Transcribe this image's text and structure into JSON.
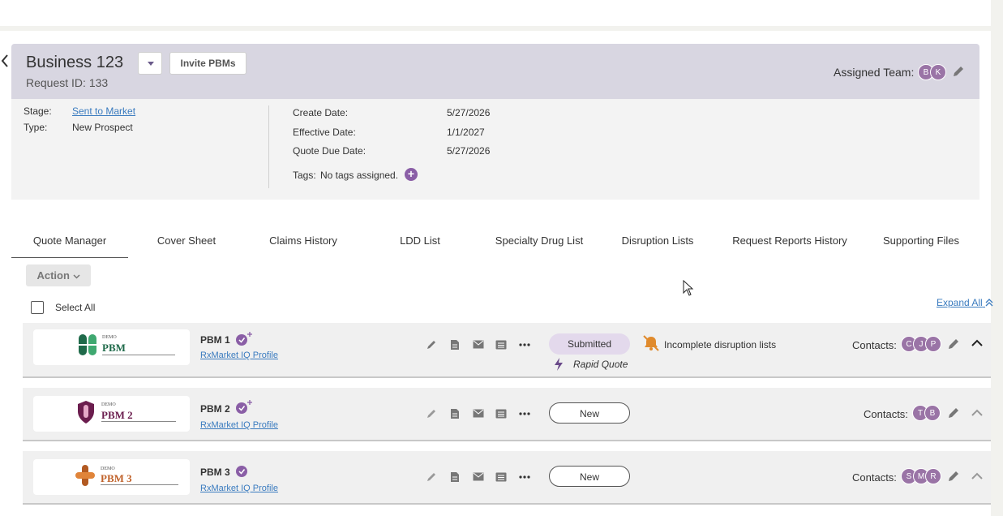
{
  "header": {
    "title": "Business 123",
    "request_id": "Request ID: 133",
    "invite_label": "Invite PBMs",
    "assigned_label": "Assigned Team:",
    "team": [
      "B",
      "K"
    ]
  },
  "details": {
    "stage_label": "Stage:",
    "stage_value": "Sent to Market",
    "type_label": "Type:",
    "type_value": "New Prospect",
    "create_label": "Create Date:",
    "create_value": "5/27/2026",
    "effective_label": "Effective Date:",
    "effective_value": "1/1/2027",
    "due_label": "Quote Due Date:",
    "due_value": "5/27/2026",
    "tags_label": "Tags:",
    "tags_value": "No tags assigned."
  },
  "tabs": [
    "Quote Manager",
    "Cover Sheet",
    "Claims History",
    "LDD List",
    "Specialty Drug List",
    "Disruption Lists",
    "Request Reports History",
    "Supporting Files"
  ],
  "toolbar": {
    "action_label": "Action",
    "select_all": "Select All",
    "expand_all": "Expand All"
  },
  "pbms": [
    {
      "name": "PBM 1",
      "logo_demo": "DEMO",
      "logo_text": "PBM",
      "profile_link": "RxMarket IQ Profile",
      "status": "Submitted",
      "sub_status": "Rapid Quote",
      "warning": "Incomplete disruption lists",
      "contacts_label": "Contacts:",
      "contacts": [
        "C",
        "J",
        "P"
      ]
    },
    {
      "name": "PBM 2",
      "logo_demo": "DEMO",
      "logo_text": "PBM 2",
      "profile_link": "RxMarket IQ Profile",
      "status": "New",
      "contacts_label": "Contacts:",
      "contacts": [
        "T",
        "B"
      ]
    },
    {
      "name": "PBM 3",
      "logo_demo": "DEMO",
      "logo_text": "PBM 3",
      "profile_link": "RxMarket IQ Profile",
      "status": "New",
      "contacts_label": "Contacts:",
      "contacts": [
        "S",
        "M",
        "R"
      ]
    }
  ],
  "colors": {
    "header_bg": "#d8d6e1",
    "accent_purple": "#8a5ea6",
    "link_blue": "#3a7bbf",
    "warning_orange": "#e08a2c"
  }
}
